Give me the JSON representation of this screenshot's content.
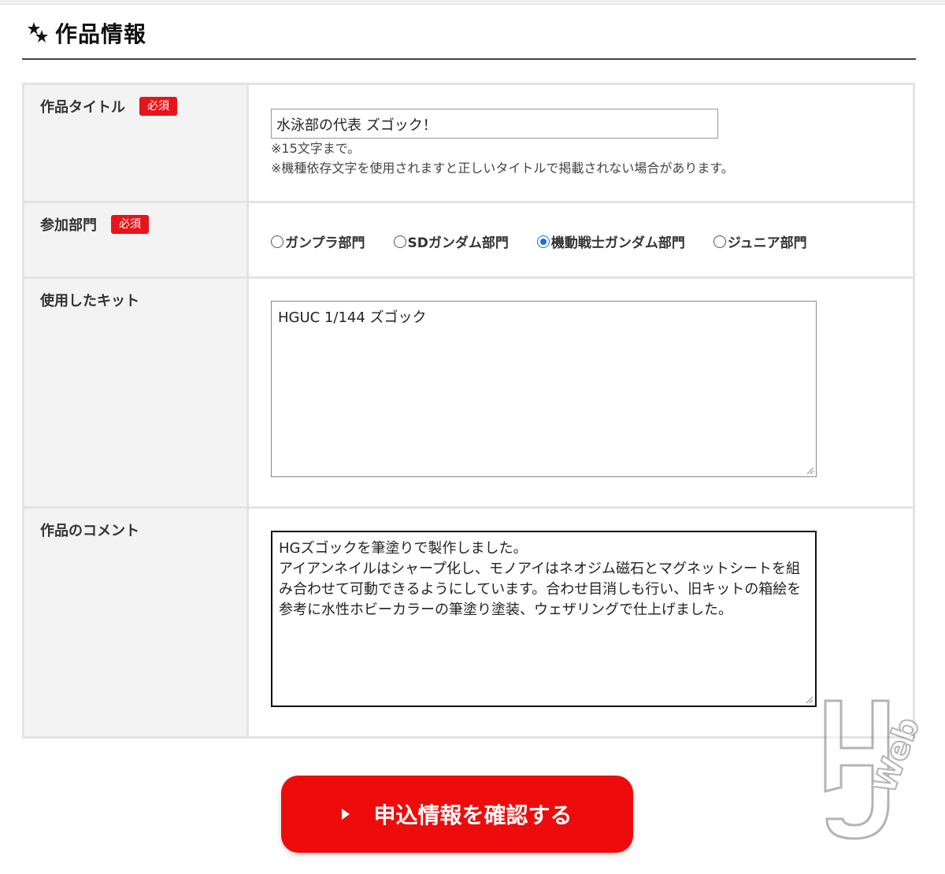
{
  "section": {
    "title": "作品情報",
    "icon": "stars-icon"
  },
  "required_label": "必須",
  "rows": {
    "title": {
      "label": "作品タイトル",
      "value": "水泳部の代表 ズゴック！",
      "note1": "※15文字まで。",
      "note2": "※機種依存文字を使用されますと正しいタイトルで掲載されない場合があります。"
    },
    "category": {
      "label": "参加部門",
      "options": [
        "ガンプラ部門",
        "SDガンダム部門",
        "機動戦士ガンダム部門",
        "ジュニア部門"
      ],
      "selected": "機動戦士ガンダム部門"
    },
    "kit": {
      "label": "使用したキット",
      "value": "HGUC 1/144 ズゴック"
    },
    "comment": {
      "label": "作品のコメント",
      "line1": "HGズゴックを筆塗りで製作しました。",
      "line2": "アイアンネイルはシャープ化し、モノアイはネオジム磁石とマグネットシートを組",
      "line3": "み合わせて可動できるようにしています。合わせ目消しも行い、旧キットの箱絵を",
      "line4": "参考に水性ホビーカラーの筆塗り塗装、ウェザリングで仕上げました。"
    }
  },
  "submit": {
    "label": "申込情報を確認する"
  },
  "colors": {
    "accent": "#ee0b0b",
    "required_badge": "#e8141b",
    "label_bg": "#f3f3f3",
    "radio_selected": "#1a6fd0"
  },
  "watermark": {
    "icon": "hj-web-logo",
    "text": "HJ Web"
  }
}
